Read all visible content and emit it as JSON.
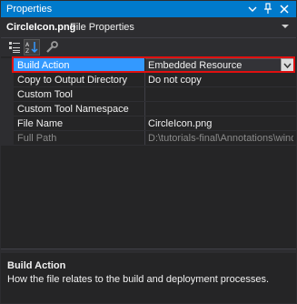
{
  "window": {
    "title": "Properties",
    "pin_icon": "pin-icon",
    "close_icon": "close-icon",
    "dropdown_icon": "chevron-down-icon"
  },
  "subject": {
    "name": "CircleIcon.png",
    "type": "File Properties"
  },
  "toolbar": {
    "buttons": [
      {
        "icon": "categorized-icon"
      },
      {
        "icon": "alphabetical-icon",
        "active": true
      },
      {
        "icon": "wrench-icon"
      }
    ]
  },
  "properties": [
    {
      "label": "Build Action",
      "value": "Embedded Resource",
      "selected": true
    },
    {
      "label": "Copy to Output Directory",
      "value": "Do not copy"
    },
    {
      "label": "Custom Tool",
      "value": ""
    },
    {
      "label": "Custom Tool Namespace",
      "value": ""
    },
    {
      "label": "File Name",
      "value": "CircleIcon.png"
    },
    {
      "label": "Full Path",
      "value": "D:\\tutorials-final\\Annotations\\window",
      "disabled": true
    }
  ],
  "description": {
    "title": "Build Action",
    "text": "How the file relates to the build and deployment processes."
  },
  "colors": {
    "accent": "#007acc",
    "selection": "#3399ff",
    "highlight_border": "#e01010",
    "background": "#252526"
  }
}
